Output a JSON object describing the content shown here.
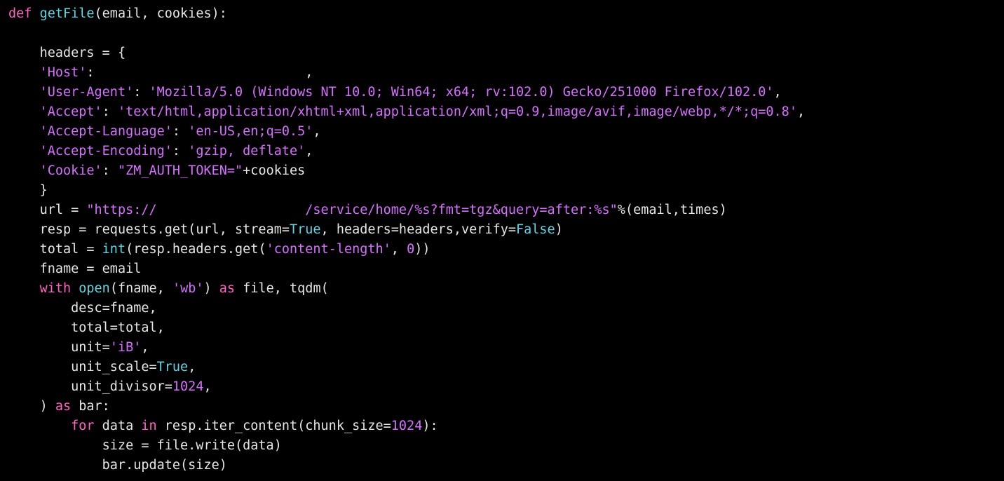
{
  "code": {
    "func_name": "getFile",
    "params": "(email, cookies)",
    "colon": ":",
    "headers_assign": "headers = {",
    "host_key": "'Host'",
    "host_sep": ":",
    "host_comma": ",",
    "ua_key": "'User-Agent'",
    "ua_val": "'Mozilla/5.0 (Windows NT 10.0; Win64; x64; rv:102.0) Gecko/251000 Firefox/102.0'",
    "accept_key": "'Accept'",
    "accept_val": "'text/html,application/xhtml+xml,application/xml;q=0.9,image/avif,image/webp,*/*;q=0.8'",
    "acclang_key": "'Accept-Language'",
    "acclang_val": "'en-US,en;q=0.5'",
    "accenc_key": "'Accept-Encoding'",
    "accenc_val": "'gzip, deflate'",
    "cookie_key": "'Cookie'",
    "cookie_val": "\"ZM_AUTH_TOKEN=\"",
    "cookie_plus": "+cookies",
    "brace_close": "}",
    "url_pre": "url = ",
    "url_str1": "\"https://",
    "url_gap": "                   ",
    "url_str2": "/service/home/%s?fmt=tgz&query=after:%s\"",
    "url_after": "%(email,times)",
    "resp_pre": "resp = requests.get(url, stream=",
    "true1": "True",
    "resp_mid": ", headers=headers,verify=",
    "false1": "False",
    "resp_end": ")",
    "total_pre": "total = ",
    "int_fn": "int",
    "total_mid": "(resp.headers.get(",
    "clen": "'content-length'",
    "total_mid2": ", ",
    "zero": "0",
    "total_end": "))",
    "fname_line": "fname = email",
    "with_kw": "with",
    "open_fn": "open",
    "open_args1": "(fname, ",
    "wb": "'wb'",
    "open_args2": ") ",
    "as_kw": "as",
    "file_tq": " file, tqdm(",
    "desc": "desc=fname,",
    "total": "total=total,",
    "unit_pre": "unit=",
    "unit_val": "'iB'",
    "unit_end": ",",
    "unit_scale_pre": "unit_scale=",
    "true2": "True",
    "unit_scale_end": ",",
    "unit_div_pre": "unit_divisor=",
    "n1024": "1024",
    "unit_div_end": ",",
    "paren_close": ") ",
    "as_kw2": "as",
    "bar_colon": " bar:",
    "for_kw": "for",
    "for_mid": " data ",
    "in_kw": "in",
    "iter_pre": " resp.iter_content(chunk_size=",
    "n1024b": "1024",
    "iter_end": "):",
    "size_line": "size = file.write(data)",
    "bar_line": "bar.update(size)"
  }
}
